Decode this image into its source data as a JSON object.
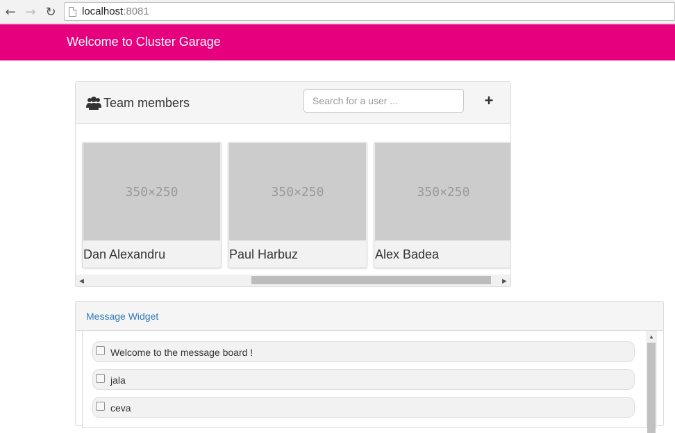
{
  "browser": {
    "back_icon": "back-arrow-icon",
    "forward_icon": "forward-arrow-icon",
    "reload_icon": "reload-icon",
    "url_host": "localhost",
    "url_port": ":8081"
  },
  "header": {
    "title": "Welcome to Cluster Garage",
    "color": "#e6007e"
  },
  "team": {
    "icon": "users-icon",
    "title": "Team members",
    "search_placeholder": "Search for a user ...",
    "add_label": "+",
    "members": [
      {
        "name": "Dan Alexandru",
        "image_text": "350×250"
      },
      {
        "name": "Paul Harbuz",
        "image_text": "350×250"
      },
      {
        "name": "Alex Badea",
        "image_text": "350×250"
      }
    ]
  },
  "messages": {
    "title": "Message Widget",
    "items": [
      {
        "text": "Welcome to the message board !",
        "checked": false
      },
      {
        "text": "jala",
        "checked": false
      },
      {
        "text": "ceva",
        "checked": false
      }
    ]
  }
}
